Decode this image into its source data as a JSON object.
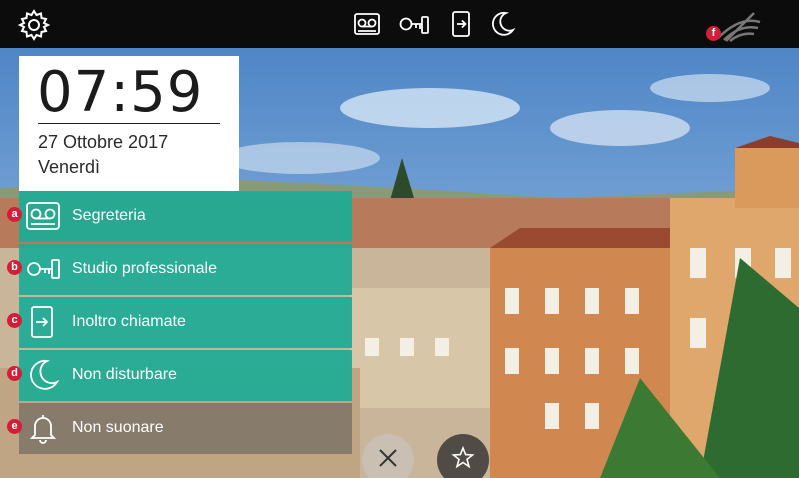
{
  "clock": {
    "time": "07:59",
    "date": "27 Ottobre 2017",
    "day": "Venerdì"
  },
  "topbar": {
    "icons": [
      "gear-icon",
      "voicemail-icon",
      "key-icon",
      "call-forward-icon",
      "moon-icon",
      "wifi-off-icon"
    ],
    "wifi_badge": "f"
  },
  "menu": {
    "items": [
      {
        "badge": "a",
        "label": "Segreteria",
        "icon": "voicemail-icon"
      },
      {
        "badge": "b",
        "label": "Studio professionale",
        "icon": "key-icon"
      },
      {
        "badge": "c",
        "label": "Inoltro chiamate",
        "icon": "call-forward-icon"
      },
      {
        "badge": "d",
        "label": "Non disturbare",
        "icon": "moon-icon"
      },
      {
        "badge": "e",
        "label": "Non suonare",
        "icon": "bell-icon"
      }
    ]
  },
  "colors": {
    "accent": "#1cab96",
    "badge": "#d41e38",
    "topbar": "#0c0c0c"
  }
}
